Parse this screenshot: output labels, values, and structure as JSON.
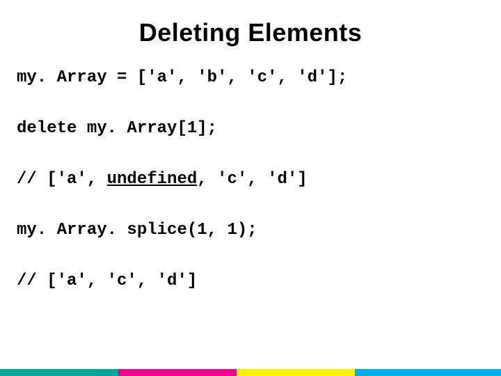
{
  "title": "Deleting Elements",
  "lines": {
    "l1": "my. Array = ['a', 'b', 'c', 'd'];",
    "l2": "delete my. Array[1];",
    "l3a": "// ['a', ",
    "l3b": "undefined",
    "l3c": ", 'c', 'd']",
    "l4": "my. Array. splice(1, 1);",
    "l5": "// ['a', 'c', 'd']"
  }
}
